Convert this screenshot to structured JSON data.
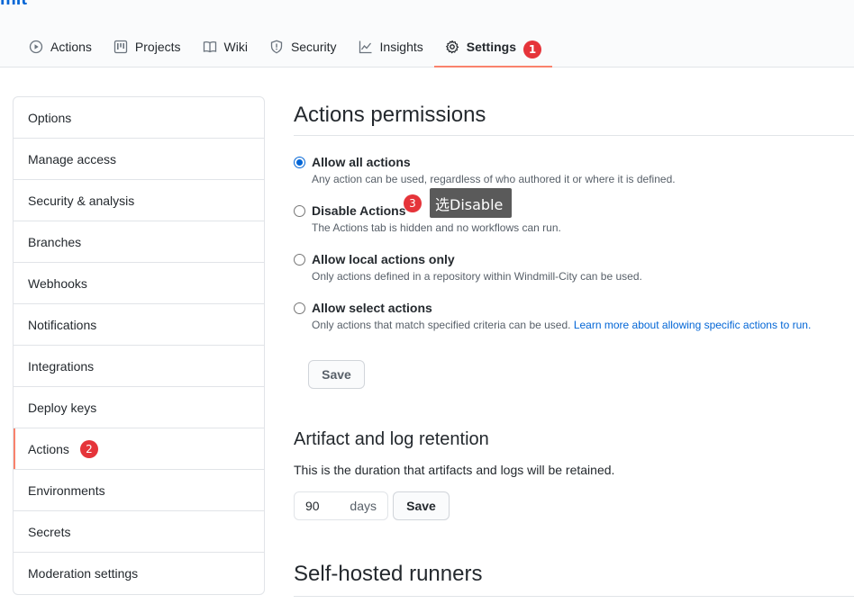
{
  "repo_fragment": "mit",
  "tabs": [
    {
      "label": "Actions",
      "icon": "play-icon"
    },
    {
      "label": "Projects",
      "icon": "project-icon"
    },
    {
      "label": "Wiki",
      "icon": "book-icon"
    },
    {
      "label": "Security",
      "icon": "shield-icon"
    },
    {
      "label": "Insights",
      "icon": "graph-icon"
    },
    {
      "label": "Settings",
      "icon": "gear-icon",
      "selected": true
    }
  ],
  "annotations": {
    "badge1": "1",
    "badge2": "2",
    "badge3": "3",
    "tooltip": "选Disable"
  },
  "sidebar": {
    "items": [
      {
        "label": "Options"
      },
      {
        "label": "Manage access"
      },
      {
        "label": "Security & analysis"
      },
      {
        "label": "Branches"
      },
      {
        "label": "Webhooks"
      },
      {
        "label": "Notifications"
      },
      {
        "label": "Integrations"
      },
      {
        "label": "Deploy keys"
      },
      {
        "label": "Actions",
        "selected": true
      },
      {
        "label": "Environments"
      },
      {
        "label": "Secrets"
      },
      {
        "label": "Moderation settings"
      }
    ]
  },
  "permissions": {
    "title": "Actions permissions",
    "options": [
      {
        "label": "Allow all actions",
        "note": "Any action can be used, regardless of who authored it or where it is defined.",
        "checked": true
      },
      {
        "label": "Disable Actions",
        "note": "The Actions tab is hidden and no workflows can run.",
        "checked": false
      },
      {
        "label": "Allow local actions only",
        "note": "Only actions defined in a repository within Windmill-City can be used.",
        "checked": false
      },
      {
        "label": "Allow select actions",
        "note": "Only actions that match specified criteria can be used.",
        "link": "Learn more about allowing specific actions to run.",
        "checked": false
      }
    ],
    "save_label": "Save"
  },
  "retention": {
    "title": "Artifact and log retention",
    "description": "This is the duration that artifacts and logs will be retained.",
    "days_value": "90",
    "days_unit": "days",
    "save_label": "Save"
  },
  "runners": {
    "title": "Self-hosted runners"
  },
  "colors": {
    "accent_link": "#0366d6",
    "selected_underline": "#f9826c",
    "badge": "#e5343a",
    "tooltip_bg": "#5a5a5a"
  }
}
